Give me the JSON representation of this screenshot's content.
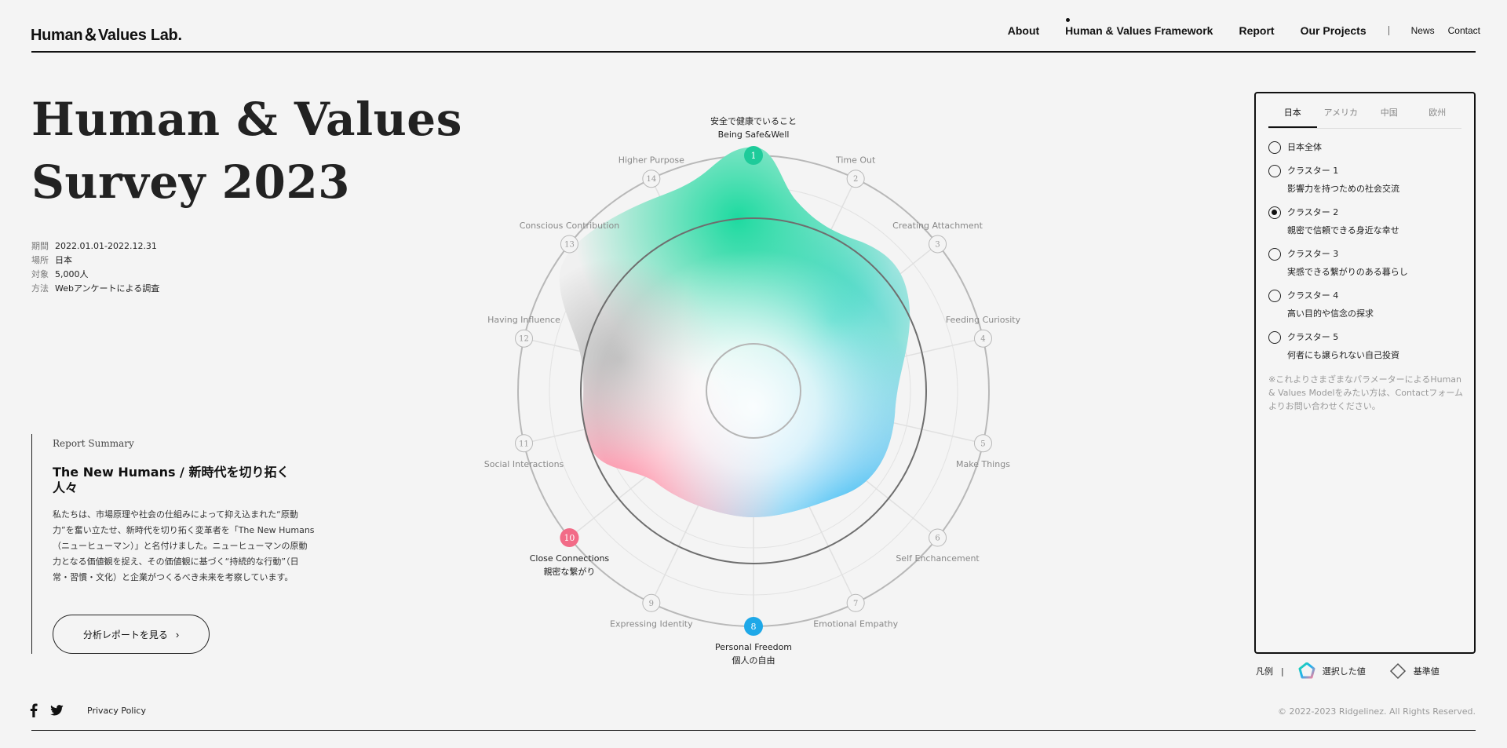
{
  "brand": {
    "logo": "Human＆Values Lab."
  },
  "nav": {
    "items": [
      "About",
      "Human & Values Framework",
      "Report",
      "Our Projects"
    ],
    "small": [
      "News",
      "Contact"
    ]
  },
  "hero": {
    "title_line1": "Human & Values",
    "title_line2": "Survey 2023"
  },
  "meta": [
    {
      "label": "期間",
      "value": "2022.01.01-2022.12.31"
    },
    {
      "label": "場所",
      "value": "日本"
    },
    {
      "label": "対象",
      "value": "5,000人"
    },
    {
      "label": "方法",
      "value": "Webアンケートによる調査"
    }
  ],
  "summary": {
    "label": "Report Summary",
    "heading": "The New Humans / 新時代を切り拓く人々",
    "body": "私たちは、市場原理や社会の仕組みによって抑え込まれた“原動力”を奮い立たせ、新時代を切り拓く変革者を「The New Humans（ニューヒューマン）」と名付けました。ニューヒューマンの原動力となる価値観を捉え、その価値観に基づく“持続的な行動”（日常・習慣・文化）と企業がつくるべき未来を考察しています。",
    "button": "分析レポートを見る"
  },
  "radar": {
    "items": [
      {
        "n": "1",
        "label": "Being Safe&Well",
        "ja": "安全で健康でいること",
        "highlight": "#1ecb9a"
      },
      {
        "n": "2",
        "label": "Time Out"
      },
      {
        "n": "3",
        "label": "Creating Attachment"
      },
      {
        "n": "4",
        "label": "Feeding Curiosity"
      },
      {
        "n": "5",
        "label": "Make Things"
      },
      {
        "n": "6",
        "label": "Self Enchancement"
      },
      {
        "n": "7",
        "label": "Emotional Empathy"
      },
      {
        "n": "8",
        "label": "Personal Freedom",
        "ja": "個人の自由",
        "highlight": "#1ea8e8"
      },
      {
        "n": "9",
        "label": "Expressing Identity"
      },
      {
        "n": "10",
        "label": "Close Connections",
        "ja": "親密な繋がり",
        "highlight": "#f26b87"
      },
      {
        "n": "11",
        "label": "Social Interactions"
      },
      {
        "n": "12",
        "label": "Having Influence"
      },
      {
        "n": "13",
        "label": "Conscious Contribution"
      },
      {
        "n": "14",
        "label": "Higher Purpose"
      }
    ]
  },
  "panel": {
    "tabs": [
      "日本",
      "アメリカ",
      "中国",
      "欧州"
    ],
    "active_tab": 0,
    "options": [
      {
        "title": "日本全体",
        "sub": ""
      },
      {
        "title": "クラスター 1",
        "sub": "影響力を持つための社会交流"
      },
      {
        "title": "クラスター 2",
        "sub": "親密で信頼できる身近な幸せ"
      },
      {
        "title": "クラスター 3",
        "sub": "実感できる繋がりのある暮らし"
      },
      {
        "title": "クラスター 4",
        "sub": "高い目的や信念の探求"
      },
      {
        "title": "クラスター 5",
        "sub": "何者にも譲られない自己投資"
      }
    ],
    "selected": 2,
    "note": "※これよりさまざまなパラメーターによるHuman & Values Modelをみたい方は、Contactフォームよりお問い合わせください。"
  },
  "legend": {
    "label": "凡例",
    "selected": "選択した値",
    "baseline": "基準値"
  },
  "footer": {
    "privacy": "Privacy Policy",
    "copyright": "© 2022-2023 Ridgelinez. All Rights Reserved."
  }
}
